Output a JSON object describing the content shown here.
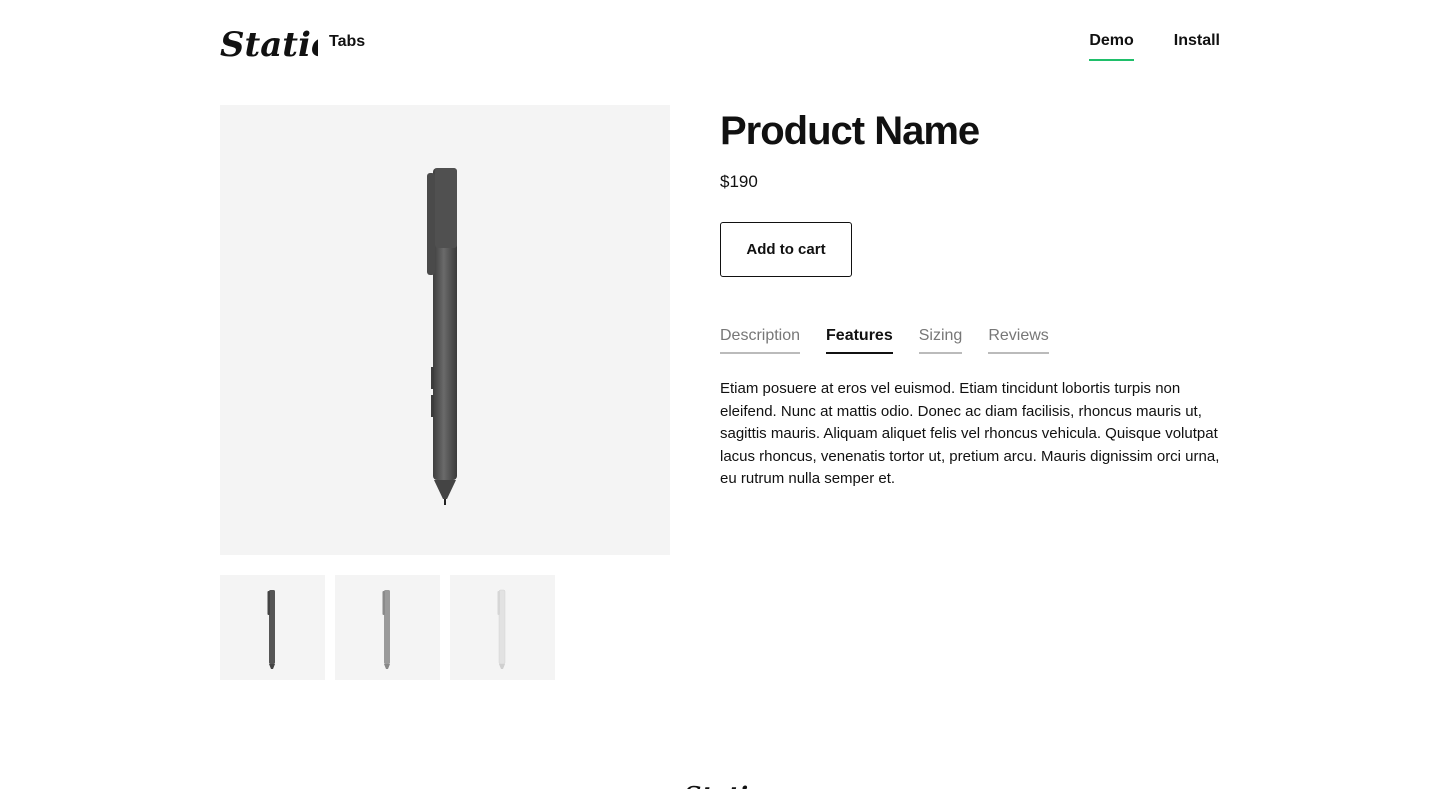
{
  "header": {
    "brand": "Station",
    "subtitle": "Tabs",
    "nav": [
      {
        "label": "Demo",
        "active": true
      },
      {
        "label": "Install",
        "active": false
      }
    ]
  },
  "product": {
    "name": "Product Name",
    "price": "$190",
    "add_to_cart": "Add to cart",
    "tabs": [
      {
        "label": "Description",
        "active": false
      },
      {
        "label": "Features",
        "active": true
      },
      {
        "label": "Sizing",
        "active": false
      },
      {
        "label": "Reviews",
        "active": false
      }
    ],
    "tab_content": "Etiam posuere at eros vel euismod. Etiam tincidunt lobortis turpis non eleifend. Nunc at mattis odio. Donec ac diam facilisis, rhoncus mauris ut, sagittis mauris. Aliquam aliquet felis vel rhoncus vehicula. Quisque volutpat lacus rhoncus, venenatis tortor ut, pretium arcu. Mauris dignissim orci urna, eu rutrum nulla semper et.",
    "images": [
      {
        "variant": "charcoal",
        "color": "#555555",
        "selected": true
      },
      {
        "variant": "silver",
        "color": "#9a9a9a",
        "selected": false
      },
      {
        "variant": "white",
        "color": "#e2e2e2",
        "selected": false
      }
    ]
  },
  "colors": {
    "accent": "#1fbf6a",
    "image_bg": "#f4f4f4",
    "text": "#111111"
  }
}
